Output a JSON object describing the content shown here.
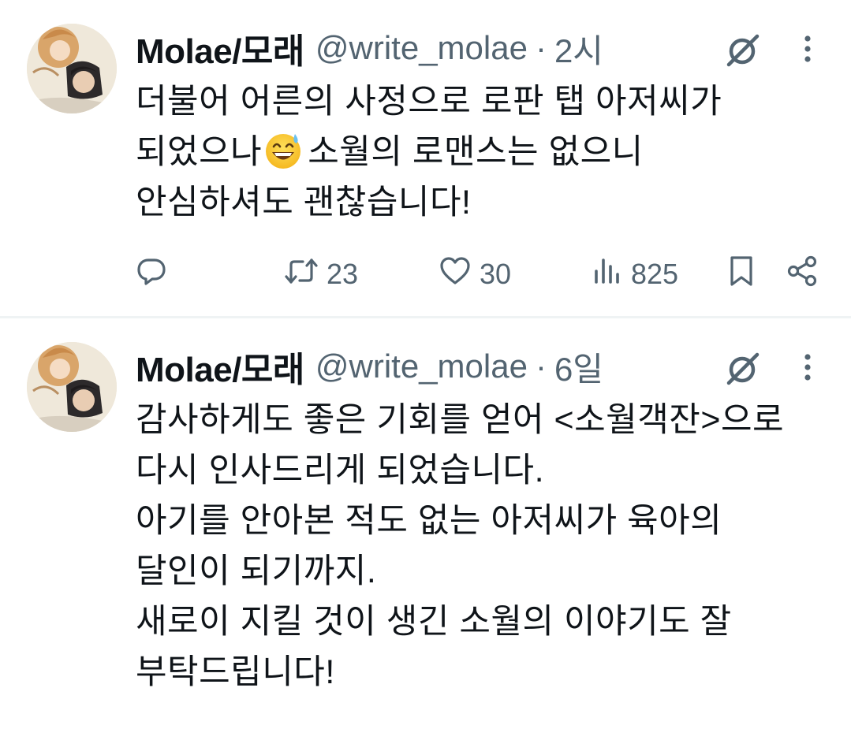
{
  "icons": {
    "grok": "grok-icon",
    "more": "more-dots-icon",
    "reply": "reply-icon",
    "retweet": "retweet-icon",
    "like": "heart-icon",
    "views": "views-chart-icon",
    "bookmark": "bookmark-icon",
    "share": "share-icon",
    "emoji": "grinning-sweat-emoji"
  },
  "colors": {
    "text": "#0f1419",
    "secondary": "#536471",
    "divider": "#eff3f4"
  },
  "tweets": [
    {
      "author": {
        "display_name": "Molae/모래",
        "handle": "@write_molae"
      },
      "separator": "·",
      "time": "2시",
      "text_lines": [
        "더불어 어른의 사정으로 로판 탭 아저씨가",
        "되었으나",
        "소월의 로맨스는 없으니",
        "안심하셔도 괜찮습니다!"
      ],
      "stats": {
        "replies": "",
        "retweets": "23",
        "likes": "30",
        "views": "825"
      }
    },
    {
      "author": {
        "display_name": "Molae/모래",
        "handle": "@write_molae"
      },
      "separator": "·",
      "time": "6일",
      "text_lines": [
        "감사하게도 좋은 기회를 얻어 <소월객잔>으로",
        "다시 인사드리게 되었습니다.",
        "아기를 안아본 적도 없는 아저씨가 육아의",
        "달인이 되기까지.",
        "새로이 지킬 것이 생긴 소월의 이야기도 잘",
        "부탁드립니다!"
      ]
    }
  ]
}
